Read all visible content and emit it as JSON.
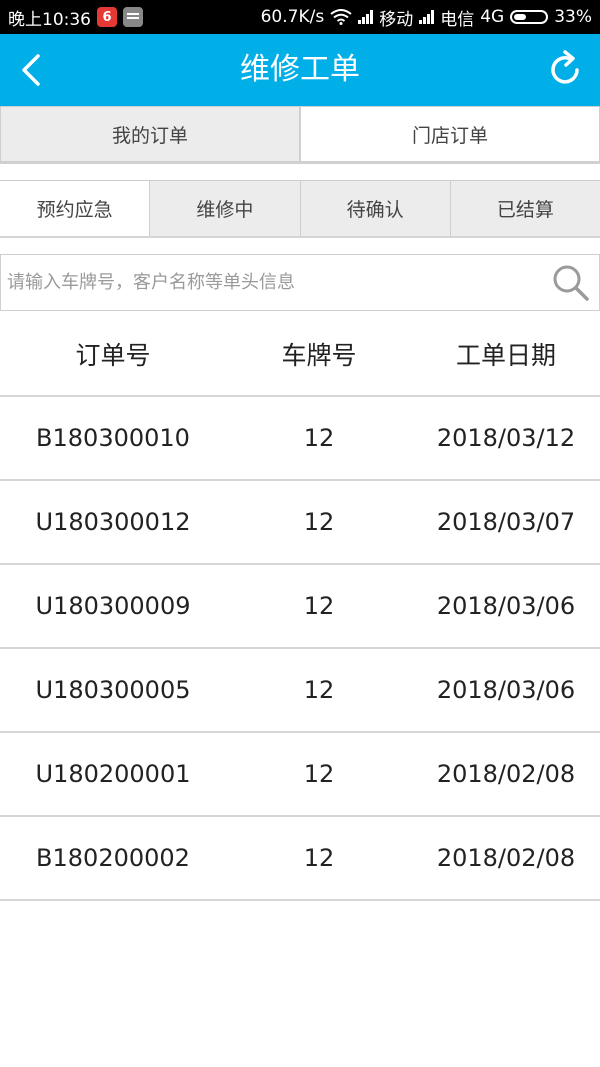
{
  "status_bar": {
    "time": "晚上10:36",
    "speed": "60.7K/s",
    "carrier1": "移动",
    "carrier2": "电信",
    "network": "4G",
    "battery": "33%"
  },
  "header": {
    "title": "维修工单",
    "back_icon": "chevron-left-icon",
    "refresh_icon": "refresh-icon",
    "bg_color": "#00aee8"
  },
  "order_scope_tabs": [
    {
      "label": "我的订单",
      "active": false
    },
    {
      "label": "门店订单",
      "active": true
    }
  ],
  "status_tabs": [
    {
      "label": "预约应急",
      "active": true
    },
    {
      "label": "维修中",
      "active": false
    },
    {
      "label": "待确认",
      "active": false
    },
    {
      "label": "已结算",
      "active": false
    }
  ],
  "search": {
    "placeholder": "请输入车牌号，客户名称等单头信息",
    "value": ""
  },
  "table": {
    "columns": [
      "订单号",
      "车牌号",
      "工单日期"
    ],
    "rows": [
      [
        "B180300010",
        "12",
        "2018/03/12"
      ],
      [
        "U180300012",
        "12",
        "2018/03/07"
      ],
      [
        "U180300009",
        "12",
        "2018/03/06"
      ],
      [
        "U180300005",
        "12",
        "2018/03/06"
      ],
      [
        "U180200001",
        "12",
        "2018/02/08"
      ],
      [
        "B180200002",
        "12",
        "2018/02/08"
      ]
    ]
  }
}
